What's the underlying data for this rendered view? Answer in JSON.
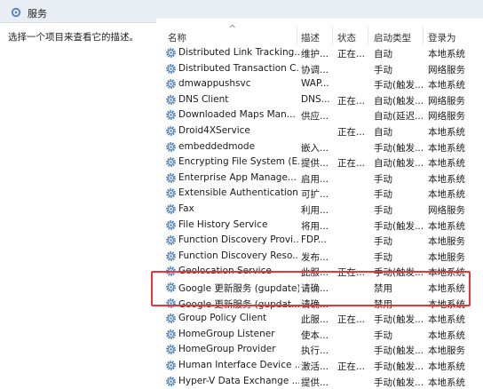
{
  "window": {
    "title": "服务"
  },
  "left_panel": {
    "description": "选择一个项目来查看它的描述。"
  },
  "table": {
    "columns": {
      "name": "名称",
      "description": "描述",
      "status": "状态",
      "startup": "启动类型",
      "logon": "登录为"
    },
    "sort_indicator": "^",
    "rows": [
      {
        "name": "Distributed Link Tracking...",
        "description": "维护...",
        "status": "正在...",
        "startup": "自动",
        "logon": "本地系统"
      },
      {
        "name": "Distributed Transaction C...",
        "description": "协调...",
        "status": "",
        "startup": "手动",
        "logon": "网络服务"
      },
      {
        "name": "dmwappushsvc",
        "description": "WAP...",
        "status": "",
        "startup": "手动(触发...",
        "logon": "本地系统"
      },
      {
        "name": "DNS Client",
        "description": "DNS...",
        "status": "正在...",
        "startup": "自动(触发...",
        "logon": "网络服务"
      },
      {
        "name": "Downloaded Maps Man...",
        "description": "供应...",
        "status": "",
        "startup": "自动(延迟...",
        "logon": "网络服务"
      },
      {
        "name": "Droid4XService",
        "description": "",
        "status": "正在...",
        "startup": "自动",
        "logon": "本地系统"
      },
      {
        "name": "embeddedmode",
        "description": "嵌入...",
        "status": "",
        "startup": "手动(触发...",
        "logon": "本地系统"
      },
      {
        "name": "Encrypting File System (E...",
        "description": "提供...",
        "status": "正在...",
        "startup": "自动(触发...",
        "logon": "本地系统"
      },
      {
        "name": "Enterprise App Manage...",
        "description": "启用...",
        "status": "",
        "startup": "手动",
        "logon": "本地系统"
      },
      {
        "name": "Extensible Authentication...",
        "description": "可扩...",
        "status": "",
        "startup": "手动",
        "logon": "本地系统"
      },
      {
        "name": "Fax",
        "description": "利用...",
        "status": "",
        "startup": "手动",
        "logon": "网络服务"
      },
      {
        "name": "File History Service",
        "description": "将用...",
        "status": "",
        "startup": "手动(触发...",
        "logon": "本地系统"
      },
      {
        "name": "Function Discovery Provi...",
        "description": "FDP...",
        "status": "",
        "startup": "手动",
        "logon": "本地服务"
      },
      {
        "name": "Function Discovery Reso...",
        "description": "发布...",
        "status": "",
        "startup": "手动",
        "logon": "本地服务"
      },
      {
        "name": "Geolocation Service",
        "description": "此服...",
        "status": "正在...",
        "startup": "手动(触发...",
        "logon": "本地系统"
      },
      {
        "name": "Google 更新服务 (gupdate)",
        "description": "请确...",
        "status": "",
        "startup": "禁用",
        "logon": "本地系统"
      },
      {
        "name": "Google 更新服务 (gupdat...",
        "description": "请确...",
        "status": "",
        "startup": "禁用",
        "logon": "本地系统"
      },
      {
        "name": "Group Policy Client",
        "description": "此服...",
        "status": "正在...",
        "startup": "手动(触发...",
        "logon": "本地系统"
      },
      {
        "name": "HomeGroup Listener",
        "description": "使本...",
        "status": "",
        "startup": "手动",
        "logon": "本地系统"
      },
      {
        "name": "HomeGroup Provider",
        "description": "执行...",
        "status": "",
        "startup": "手动(触发...",
        "logon": "本地服务"
      },
      {
        "name": "Human Interface Device ...",
        "description": "激活...",
        "status": "正在...",
        "startup": "手动(触发...",
        "logon": "本地系统"
      },
      {
        "name": "Hyper-V Data Exchange ...",
        "description": "提供...",
        "status": "",
        "startup": "手动(触发...",
        "logon": "本地系统"
      }
    ]
  },
  "colors": {
    "highlight_border": "#e8353c",
    "titlebar_bg": "#e9eef5",
    "gear_icon": "#4a7ab0"
  }
}
